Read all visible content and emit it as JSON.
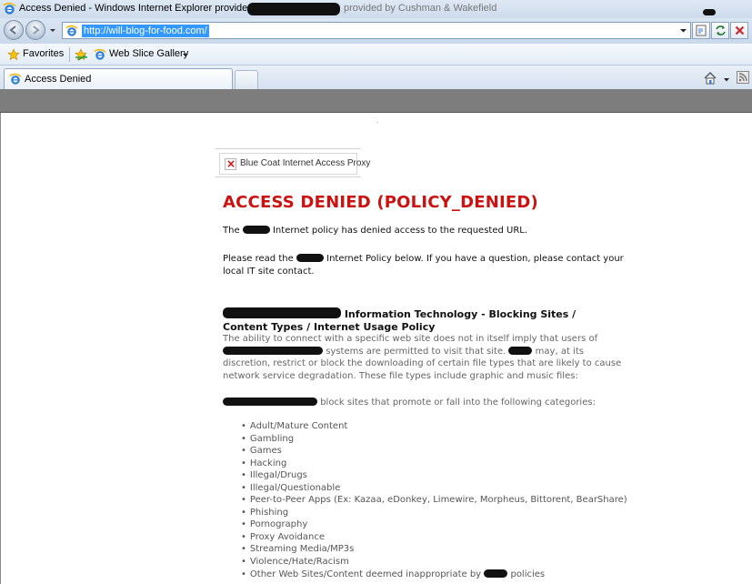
{
  "window": {
    "title_left": "Access Denied - Windows Internet Explorer provided by",
    "title_right": "provided by Cushman & Wakefield"
  },
  "address_bar": {
    "url": "http://will-blog-for-food.com/"
  },
  "favorites_bar": {
    "favorites_label": "Favorites",
    "web_slice_label": "Web Slice Gallery"
  },
  "tab": {
    "label": "Access Denied"
  },
  "page": {
    "proxy_label": "Blue Coat Internet Access Proxy",
    "heading": "ACCESS DENIED (POLICY_DENIED)",
    "p1_a": "The",
    "p1_b": "Internet policy has denied access to the requested URL.",
    "p2_a": "Please read the",
    "p2_b": "Internet Policy below. If you have a question, please contact your local IT site contact.",
    "section_title": "Information Technology - Blocking Sites / Content Types / Internet Usage Policy",
    "p3_a": "The ability to connect with a specific web site does not in itself imply that users of",
    "p3_b": "systems are permitted to visit that site.",
    "p3_c": "may, at its discretion, restrict or block the downloading of certain file types that are likely to cause network service degradation. These file types include graphic and music files:",
    "p4": "block sites that promote or fall into the following categories:",
    "categories": [
      "Adult/Mature Content",
      "Gambling",
      "Games",
      "Hacking",
      "Illegal/Drugs",
      "Illegal/Questionable",
      "Peer-to-Peer Apps (Ex: Kazaa, eDonkey, Limewire, Morpheus, Bittorent, BearShare)",
      "Phishing",
      "Pornography",
      "Proxy Avoidance",
      "Streaming Media/MP3s",
      "Violence/Hate/Racism"
    ],
    "last_category_a": "Other Web Sites/Content deemed inappropriate by",
    "last_category_b": "policies"
  },
  "colors": {
    "heading_red": "#cc1111",
    "url_highlight": "#3399ff",
    "band_gray": "#7d7d7d"
  }
}
